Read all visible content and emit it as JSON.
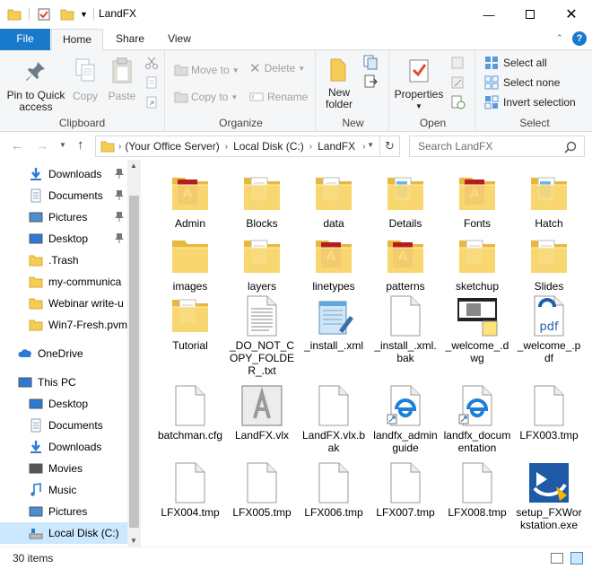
{
  "window": {
    "title": "LandFX"
  },
  "tabs": {
    "file": "File",
    "home": "Home",
    "share": "Share",
    "view": "View"
  },
  "ribbon": {
    "clipboard": {
      "label": "Clipboard",
      "pin": "Pin to Quick access",
      "copy": "Copy",
      "paste": "Paste"
    },
    "organize": {
      "label": "Organize",
      "move_to": "Move to",
      "copy_to": "Copy to",
      "delete": "Delete",
      "rename": "Rename"
    },
    "new": {
      "label": "New",
      "new_folder": "New folder"
    },
    "open": {
      "label": "Open",
      "properties": "Properties"
    },
    "select": {
      "label": "Select",
      "select_all": "Select all",
      "select_none": "Select none",
      "invert": "Invert selection"
    }
  },
  "address": {
    "crumbs": [
      "(Your Office Server)",
      "Local Disk (C:)",
      "LandFX"
    ],
    "search_placeholder": "Search LandFX"
  },
  "nav": {
    "items": [
      {
        "label": "Downloads",
        "icon": "download-icon",
        "pinned": true
      },
      {
        "label": "Documents",
        "icon": "documents-icon",
        "pinned": true
      },
      {
        "label": "Pictures",
        "icon": "pictures-icon",
        "pinned": true
      },
      {
        "label": "Desktop",
        "icon": "desktop-icon",
        "pinned": true
      },
      {
        "label": ".Trash",
        "icon": "folder-icon",
        "pinned": false
      },
      {
        "label": "my-communica",
        "icon": "folder-icon",
        "pinned": false
      },
      {
        "label": "Webinar write-u",
        "icon": "folder-icon",
        "pinned": false
      },
      {
        "label": "Win7-Fresh.pvm",
        "icon": "folder-icon",
        "pinned": false
      },
      {
        "label": "OneDrive",
        "icon": "onedrive-icon",
        "pinned": false
      },
      {
        "label": "This PC",
        "icon": "computer-icon",
        "pinned": false
      },
      {
        "label": "Desktop",
        "icon": "desktop-icon",
        "pinned": false
      },
      {
        "label": "Documents",
        "icon": "documents-icon",
        "pinned": false
      },
      {
        "label": "Downloads",
        "icon": "download-icon",
        "pinned": false
      },
      {
        "label": "Movies",
        "icon": "movies-icon",
        "pinned": false
      },
      {
        "label": "Music",
        "icon": "music-icon",
        "pinned": false
      },
      {
        "label": "Pictures",
        "icon": "pictures-icon",
        "pinned": false
      },
      {
        "label": "Local Disk (C:)",
        "icon": "drive-icon",
        "pinned": false
      }
    ]
  },
  "files": [
    {
      "name": "Admin",
      "type": "folder-autocad"
    },
    {
      "name": "Blocks",
      "type": "folder-doc"
    },
    {
      "name": "data",
      "type": "folder-doc"
    },
    {
      "name": "Details",
      "type": "folder-blue"
    },
    {
      "name": "Fonts",
      "type": "folder-autocad"
    },
    {
      "name": "Hatch",
      "type": "folder-blue"
    },
    {
      "name": "images",
      "type": "folder"
    },
    {
      "name": "layers",
      "type": "folder-doc"
    },
    {
      "name": "linetypes",
      "type": "folder-autocad"
    },
    {
      "name": "patterns",
      "type": "folder-autocad"
    },
    {
      "name": "sketchup",
      "type": "folder-doc"
    },
    {
      "name": "Slides",
      "type": "folder-doc"
    },
    {
      "name": "Tutorial",
      "type": "folder-doc"
    },
    {
      "name": "_DO_NOT_COPY_FOLDER_.txt",
      "type": "text"
    },
    {
      "name": "_install_.xml",
      "type": "notepad"
    },
    {
      "name": "_install_.xml.bak",
      "type": "blank"
    },
    {
      "name": "_welcome_.dwg",
      "type": "dwg"
    },
    {
      "name": "_welcome_.pdf",
      "type": "pdf"
    },
    {
      "name": "batchman.cfg",
      "type": "blank"
    },
    {
      "name": "LandFX.vlx",
      "type": "vlx"
    },
    {
      "name": "LandFX.vlx.bak",
      "type": "blank"
    },
    {
      "name": "landfx_adminguide",
      "type": "edge"
    },
    {
      "name": "landfx_documentation",
      "type": "edge"
    },
    {
      "name": "LFX003.tmp",
      "type": "blank"
    },
    {
      "name": "LFX004.tmp",
      "type": "blank"
    },
    {
      "name": "LFX005.tmp",
      "type": "blank"
    },
    {
      "name": "LFX006.tmp",
      "type": "blank"
    },
    {
      "name": "LFX007.tmp",
      "type": "blank"
    },
    {
      "name": "LFX008.tmp",
      "type": "blank"
    },
    {
      "name": "setup_FXWorkstation.exe",
      "type": "setup"
    }
  ],
  "status": {
    "count": "30 items"
  },
  "colors": {
    "accent": "#1979ca",
    "selection": "#cce8ff",
    "folder": "#f5cd54"
  }
}
